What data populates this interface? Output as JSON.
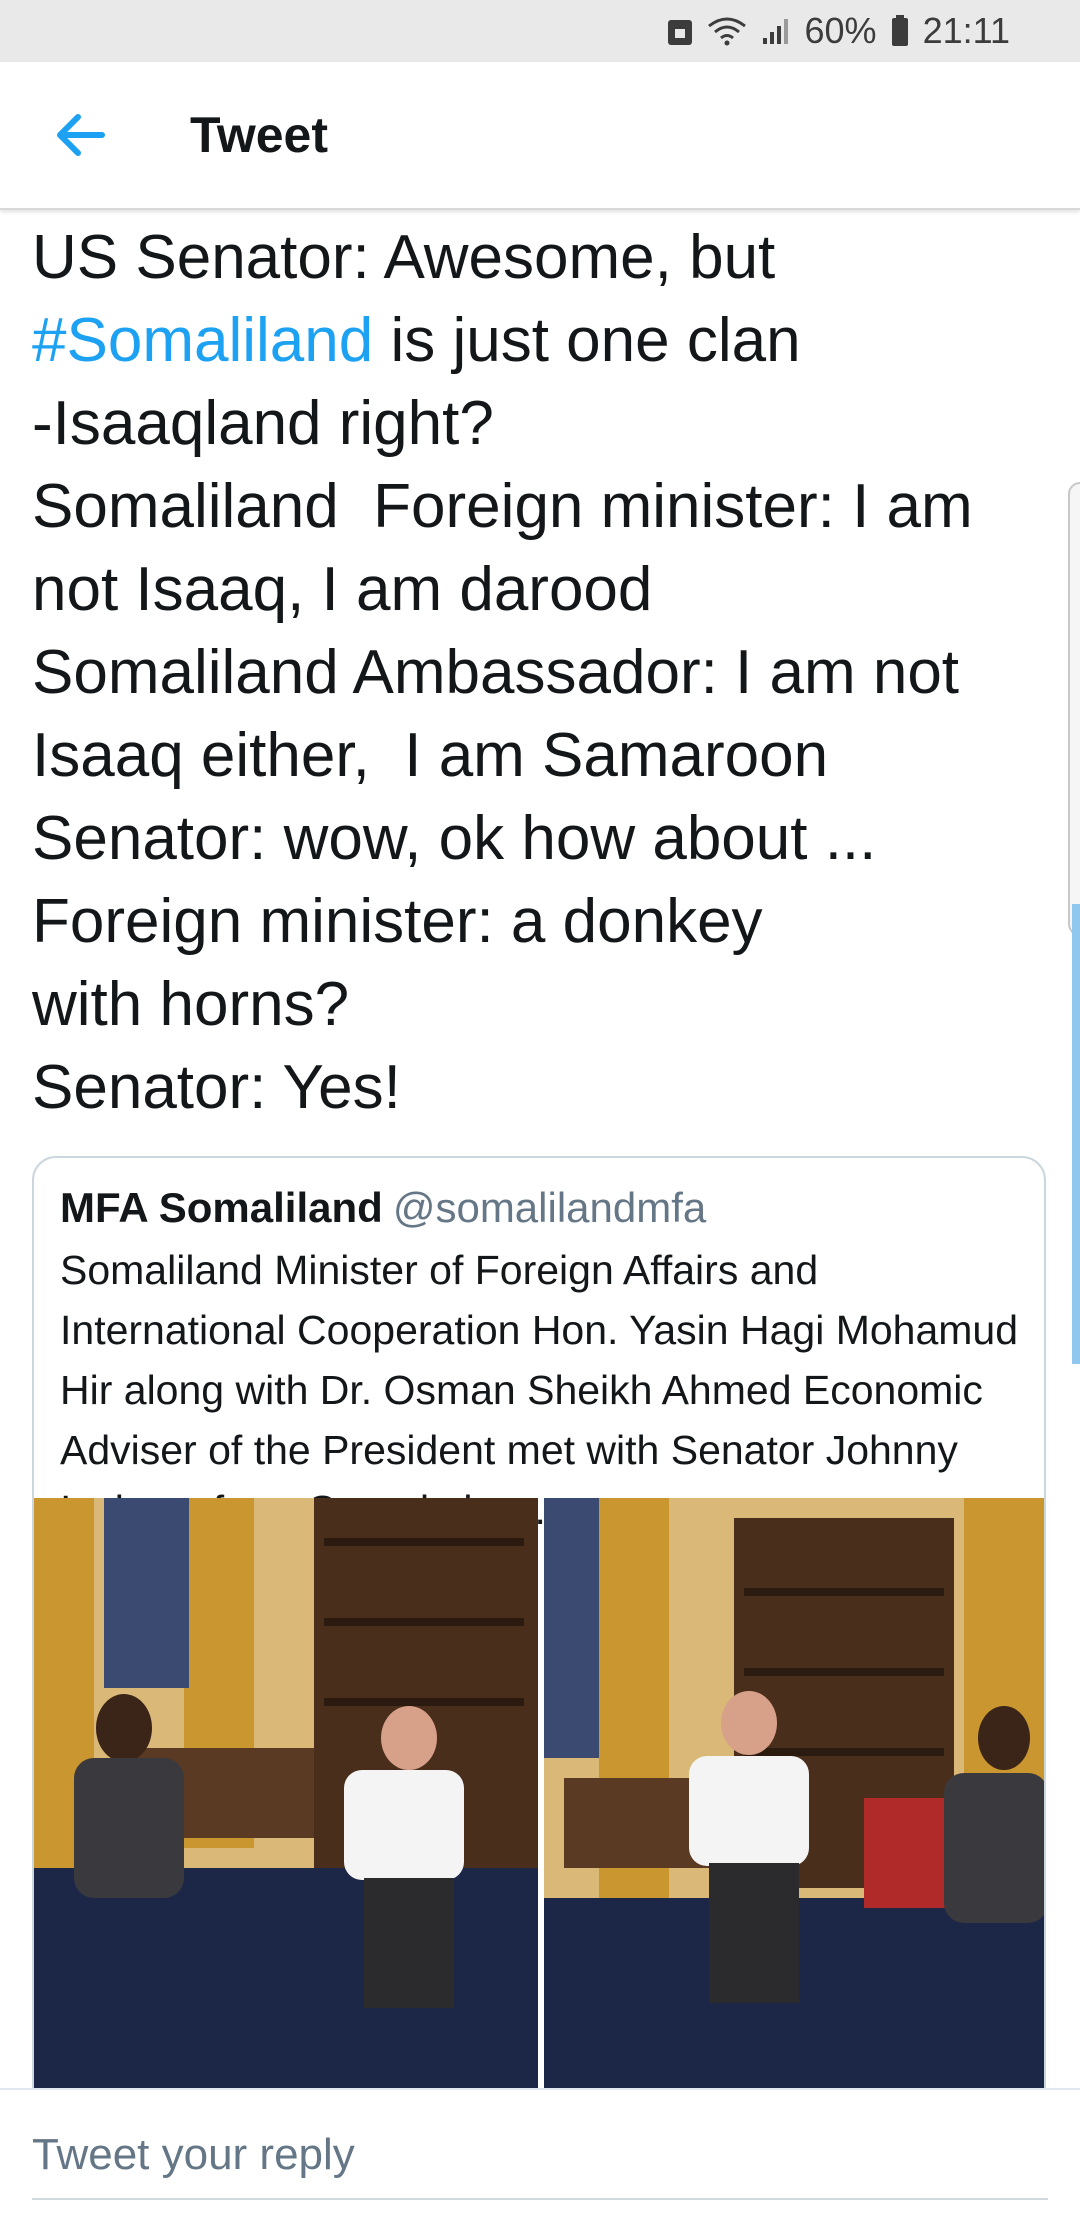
{
  "status_bar": {
    "battery": "60%",
    "time": "21:11"
  },
  "header": {
    "title": "Tweet",
    "back_icon": "arrow-left-icon"
  },
  "tweet": {
    "line1": "US Senator: Awesome, but ",
    "hashtag": "#Somaliland",
    "line2": " is just one clan\n-Isaaqland right?\nSomaliland  Foreign minister: I am not Isaaq, I am darood\nSomaliland Ambassador: I am not Isaaq either,  I am Samaroon\nSenator: wow, ok how about ...\nForeign minister: a donkey\nwith horns?\nSenator: Yes!"
  },
  "quote": {
    "name": "MFA Somaliland",
    "handle": "@somalilandmfa",
    "text": "Somaliland Minister of Foreign Affairs and International Cooperation Hon. Yasin Hagi Mohamud Hir along with Dr. Osman Sheikh Ahmed Economic Adviser of the President met with Senator Johnny Isakson from Georgia in …"
  },
  "reply": {
    "placeholder": "Tweet your reply"
  },
  "colors": {
    "accent": "#1da1f2",
    "handle": "#657786"
  }
}
